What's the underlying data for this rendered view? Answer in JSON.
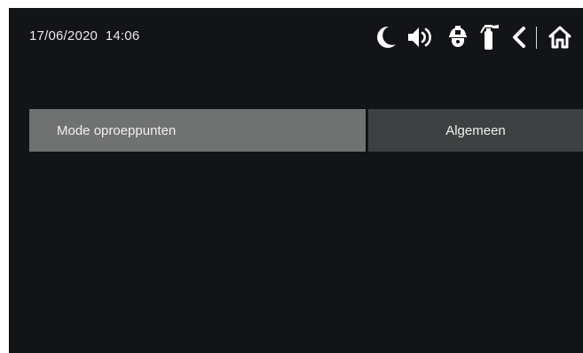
{
  "status": {
    "date": "17/06/2020",
    "time": "14:06",
    "icons": [
      "moon-icon",
      "speaker-icon",
      "helmet-icon",
      "extinguisher-icon",
      "back-chevron-icon",
      "home-icon"
    ]
  },
  "tabs": [
    {
      "label": "Mode oproeppunten",
      "selected": true
    },
    {
      "label": "Algemeen",
      "selected": false
    }
  ],
  "colors": {
    "background": "#121417",
    "tab_selected": "#6f7270",
    "tab_unselected": "#3e4142",
    "text": "#f0f0f0"
  }
}
